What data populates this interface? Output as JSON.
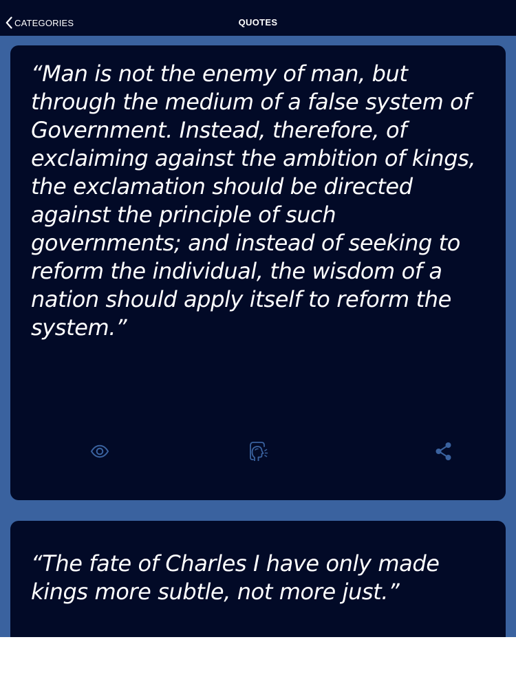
{
  "nav": {
    "back_label": "CATEGORIES",
    "title": "QUOTES"
  },
  "quotes": [
    {
      "text": "“Man is not the enemy of man, but through the medium of a false system of Government. Instead, therefore, of exclaiming against the ambition of kings, the exclamation should be directed against the principle of such governments; and instead of seeking to reform the individual, the wisdom of a nation should apply itself to reform the system.”",
      "actions": [
        "eye-icon",
        "speak-icon",
        "share-icon"
      ]
    },
    {
      "text": "“The fate of Charles I have only made kings more subtle, not more just.”"
    }
  ],
  "colors": {
    "background": "#3a629f",
    "card": "#020a27",
    "nav": "#020a27",
    "text": "#ffffff",
    "icon": "#3a629f"
  }
}
